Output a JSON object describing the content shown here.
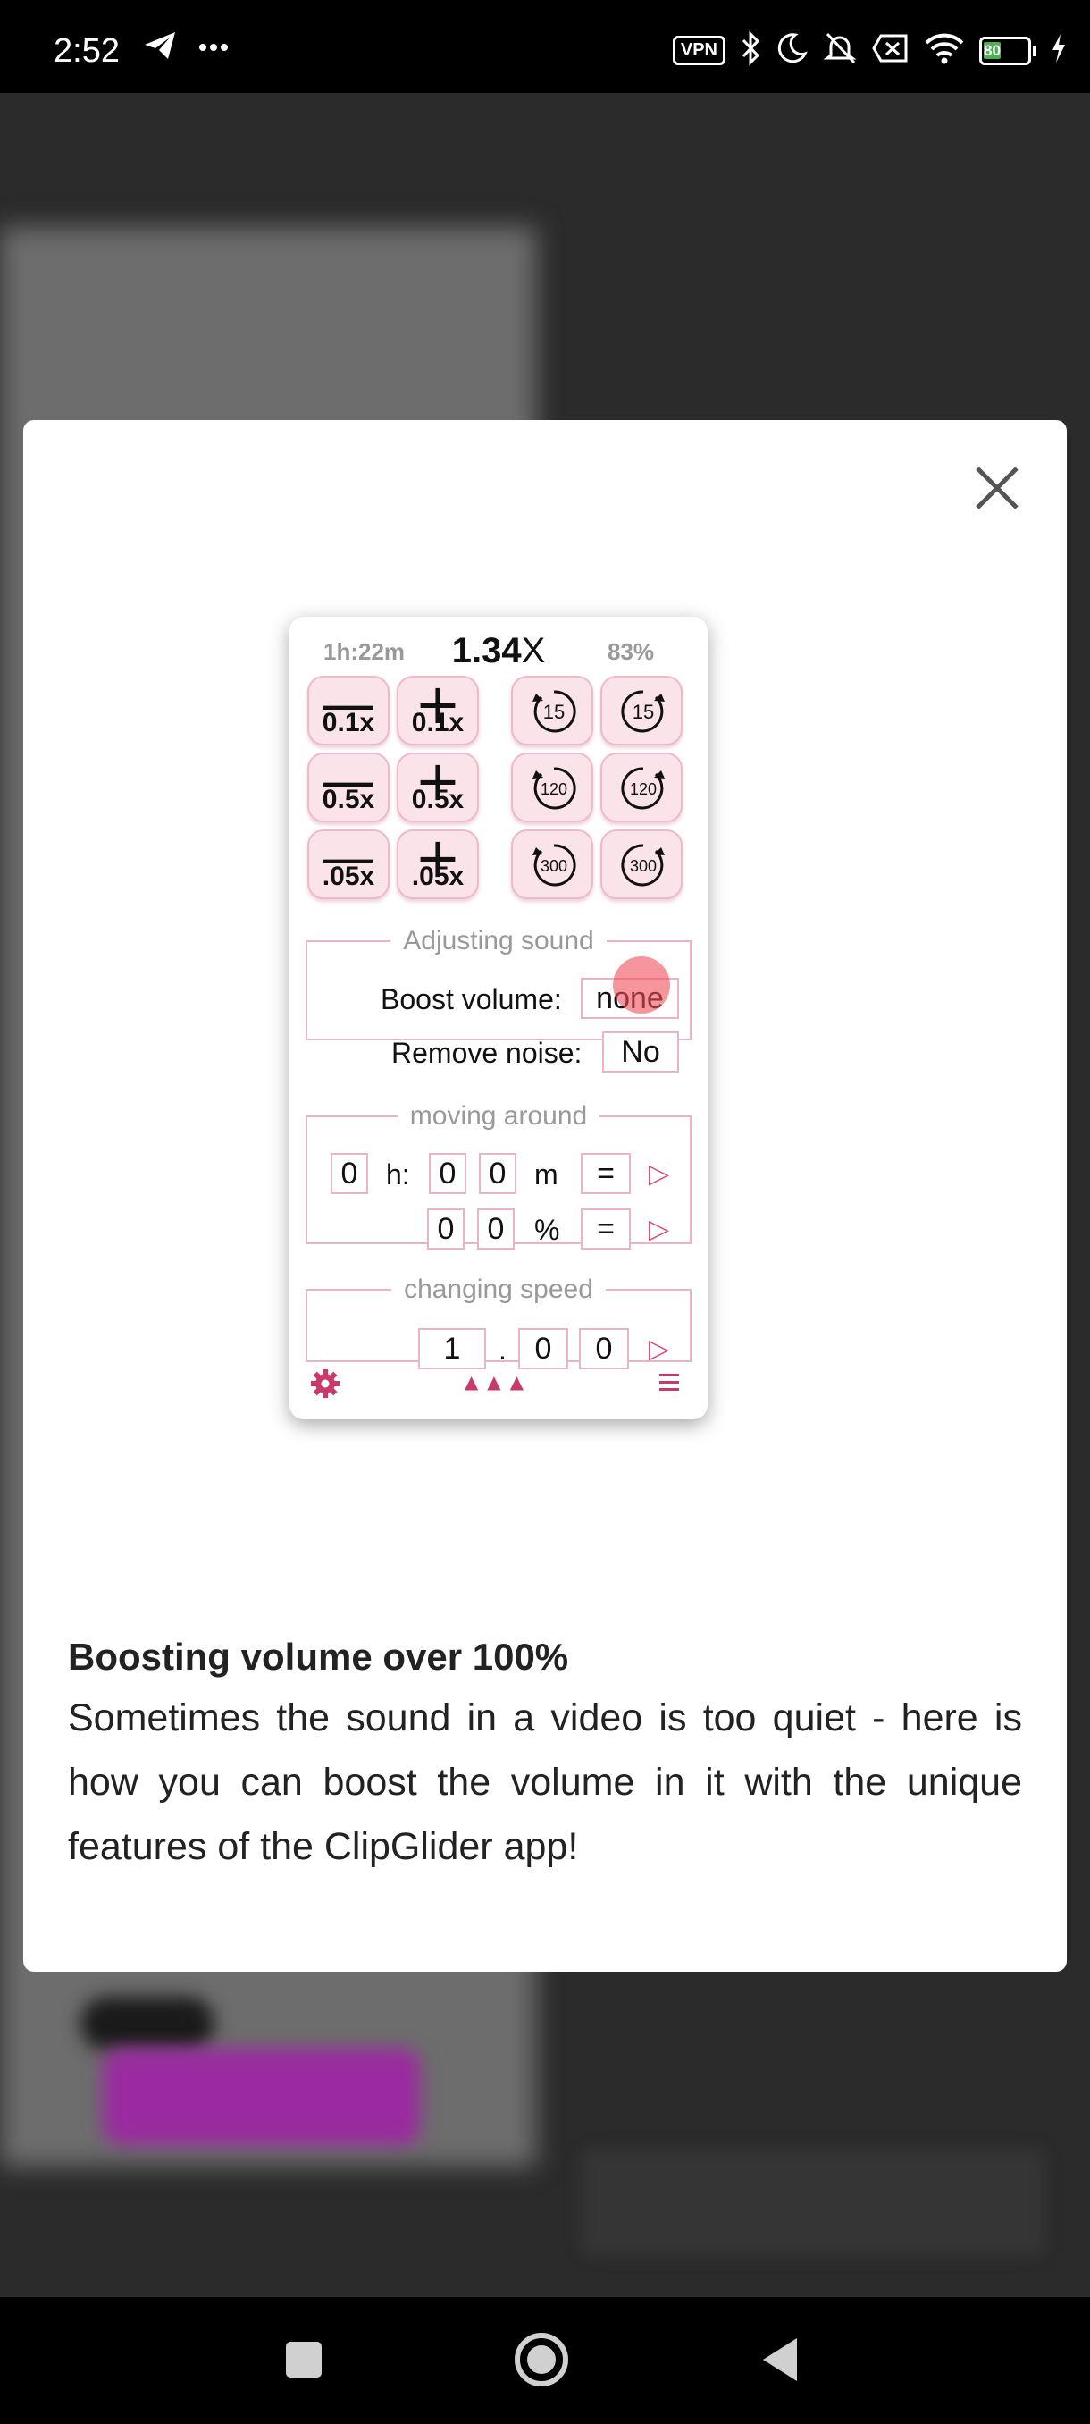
{
  "status_bar": {
    "time": "2:52",
    "vpn_label": "VPN",
    "battery_level": "80",
    "icons": [
      "telegram-icon",
      "more-dots-icon",
      "vpn-icon",
      "bluetooth-icon",
      "moon-icon",
      "mute-icon",
      "sim-off-icon",
      "wifi-icon",
      "battery-icon",
      "charging-icon"
    ]
  },
  "modal": {
    "close_icon": "close-icon",
    "heading": "Boosting volume over 100%",
    "description": "Sometimes the sound in a video is too quiet - here is how you can boost the volume in it with the unique features of the ClipGlider app!"
  },
  "preview": {
    "remaining_time": "1h:22m",
    "speed_value": "1.34",
    "speed_suffix": "X",
    "percent": "83%",
    "speed_buttons": [
      {
        "sign": "—",
        "amount": "0.1x"
      },
      {
        "sign": "+",
        "amount": "0.1x"
      },
      {
        "sign": "—",
        "amount": "0.5x"
      },
      {
        "sign": "+",
        "amount": "0.5x"
      },
      {
        "sign": "—",
        "amount": ".05x"
      },
      {
        "sign": "+",
        "amount": ".05x"
      }
    ],
    "seek_buttons": [
      {
        "direction": "back",
        "seconds": "15"
      },
      {
        "direction": "forward",
        "seconds": "15"
      },
      {
        "direction": "back",
        "seconds": "120"
      },
      {
        "direction": "forward",
        "seconds": "120"
      },
      {
        "direction": "back",
        "seconds": "300"
      },
      {
        "direction": "forward",
        "seconds": "300"
      }
    ],
    "sound": {
      "legend": "Adjusting sound",
      "boost_label": "Boost volume:",
      "boost_value": "none",
      "noise_label": "Remove noise:",
      "noise_value": "No"
    },
    "moving": {
      "legend": "moving around",
      "hours": "0",
      "h_label": "h:",
      "min_tens": "0",
      "min_ones": "0",
      "m_label": "m",
      "equals": "=",
      "pct_tens": "0",
      "pct_ones": "0",
      "pct_label": "%",
      "equals2": "="
    },
    "speed": {
      "legend": "changing speed",
      "whole": "1",
      "dot": ".",
      "tenths": "0",
      "hundredths": "0"
    },
    "play_glyph": "▷",
    "footer_arrows": "▲▲▲",
    "accent_color": "#d94f7a"
  },
  "nav_bar": {
    "icons": [
      "recents-square-icon",
      "home-circle-icon",
      "back-triangle-icon"
    ]
  }
}
